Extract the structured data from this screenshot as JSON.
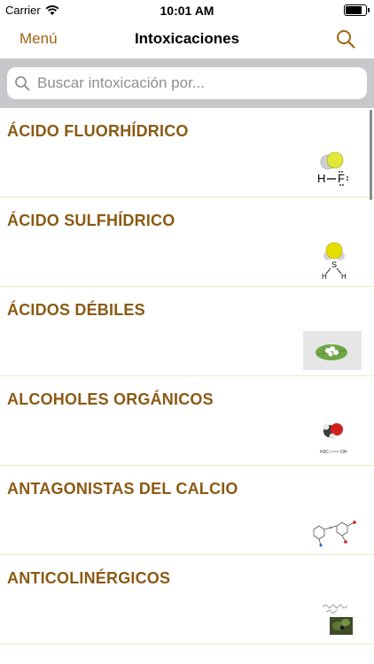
{
  "status_bar": {
    "carrier": "Carrier",
    "time": "10:01 AM",
    "battery_level": 0.9
  },
  "nav": {
    "menu_label": "Menú",
    "title": "Intoxicaciones",
    "search_icon": "search-icon"
  },
  "search": {
    "placeholder": "Buscar intoxicación por...",
    "value": ""
  },
  "items": [
    {
      "label": "ÁCIDO FLUORHÍDRICO",
      "thumb": "hf-molecule"
    },
    {
      "label": "ÁCIDO SULFHÍDRICO",
      "thumb": "h2s-molecule"
    },
    {
      "label": "ÁCIDOS DÉBILES",
      "thumb": "leaf-flowers-photo"
    },
    {
      "label": "ALCOHOLES ORGÁNICOS",
      "thumb": "alcohol-molecule"
    },
    {
      "label": "ANTAGONISTAS DEL CALCIO",
      "thumb": "calcium-antagonist-structure"
    },
    {
      "label": "ANTICOLINÉRGICOS",
      "thumb": "belladona-plant"
    }
  ],
  "colors": {
    "accent": "#a3640f",
    "item_text": "#8b5a14",
    "search_bg": "#c8c8cc",
    "divider": "#f1e6c8"
  }
}
